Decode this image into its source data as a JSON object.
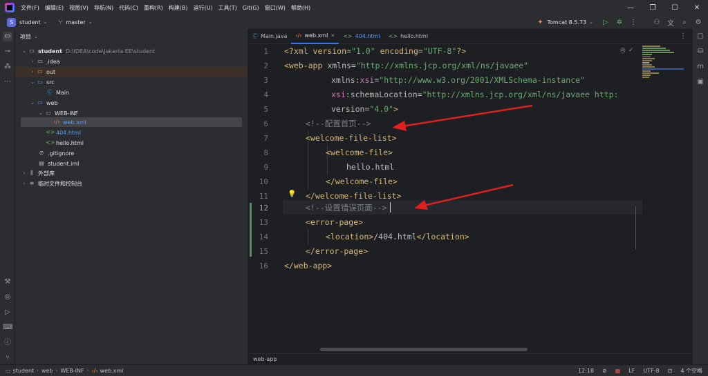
{
  "menubar": {
    "items": [
      "文件(F)",
      "编辑(E)",
      "视图(V)",
      "导航(N)",
      "代码(C)",
      "重构(R)",
      "构建(B)",
      "运行(U)",
      "工具(T)",
      "Git(G)",
      "窗口(W)",
      "帮助(H)"
    ],
    "window_controls": [
      "—",
      "❐",
      "☐",
      "✕"
    ]
  },
  "toolbar": {
    "project_badge": "S",
    "project_name": "student",
    "branch": "master",
    "run_config": "Tomcat 8.5.73"
  },
  "project_panel": {
    "header": "项目",
    "tree": [
      {
        "label": "student",
        "path": "D:\\IDEA\\code\\Jakarta EE\\student"
      },
      {
        "label": ".idea"
      },
      {
        "label": "out"
      },
      {
        "label": "src"
      },
      {
        "label": "Main"
      },
      {
        "label": "web"
      },
      {
        "label": "WEB-INF"
      },
      {
        "label": "web.xml"
      },
      {
        "label": "404.html"
      },
      {
        "label": "hello.html"
      },
      {
        "label": ".gitignore"
      },
      {
        "label": "student.iml"
      },
      {
        "label": "外部库"
      },
      {
        "label": "临时文件和控制台"
      }
    ]
  },
  "editor": {
    "tabs": [
      {
        "label": "Main.java"
      },
      {
        "label": "web.xml"
      },
      {
        "label": "404.html"
      },
      {
        "label": "hello.html"
      }
    ],
    "line_numbers": [
      "1",
      "2",
      "3",
      "4",
      "5",
      "6",
      "7",
      "8",
      "9",
      "10",
      "11",
      "12",
      "13",
      "14",
      "15",
      "16"
    ],
    "code": {
      "l1_a": "<?xml version=",
      "l1_b": "\"1.0\"",
      "l1_c": " encoding=",
      "l1_d": "\"UTF-8\"",
      "l1_e": "?>",
      "l2_a": "<web-app",
      "l2_b": " xmlns=",
      "l2_c": "\"http://xmlns.jcp.org/xml/ns/javaee\"",
      "l3_a": "xmlns:",
      "l3_b": "xsi",
      "l3_c": "=",
      "l3_d": "\"http://www.w3.org/2001/XMLSchema-instance\"",
      "l4_a": "xsi",
      "l4_b": ":schemaLocation=",
      "l4_c": "\"http://xmlns.jcp.org/xml/ns/javaee http:",
      "l5_a": "version=",
      "l5_b": "\"4.0\"",
      "l5_c": ">",
      "l6": "<!--配置首页-->",
      "l7": "<welcome-file-list>",
      "l8": "<welcome-file>",
      "l9": "hello.html",
      "l10": "</welcome-file>",
      "l11": "</welcome-file-list>",
      "l12": "<!--设置错误页面-->",
      "l13": "<error-page>",
      "l14_a": "<location>",
      "l14_b": "/404.html",
      "l14_c": "</location>",
      "l15": "</error-page>",
      "l16": "</web-app>"
    },
    "breadcrumb": "web-app"
  },
  "statusbar": {
    "crumbs": [
      "student",
      "web",
      "WEB-INF",
      "web.xml"
    ],
    "position": "12:18",
    "line_separator": "LF",
    "encoding": "UTF-8",
    "indent": "4 个空格"
  },
  "colors": {
    "accent": "#3574f0",
    "annotation_arrow": "#e02020",
    "xml_tag": "#d5b778",
    "xml_value": "#6aab73",
    "comment": "#7a7e85"
  }
}
